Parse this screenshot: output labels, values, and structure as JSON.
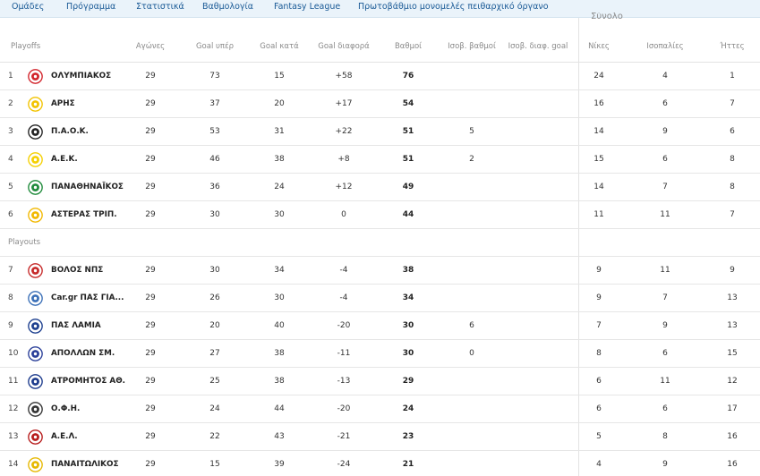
{
  "nav": {
    "items": [
      "Ομάδες",
      "Πρόγραμμα",
      "Στατιστικά",
      "Βαθμολογία",
      "Fantasy League",
      "Πρωτοβάθμιο μονομελές πειθαρχικό όργανο"
    ]
  },
  "group_header_partial": "Σύνολο",
  "table": {
    "playoffs_label": "Playoffs",
    "playouts_label": "Playouts",
    "columns": [
      "Αγώνες",
      "Goal υπέρ",
      "Goal κατά",
      "Goal διαφορά",
      "Βαθμοί",
      "Ισοβ. βαθμοί",
      "Ισοβ. διαφ. goal",
      "Νίκες",
      "Ισοπαλίες",
      "Ήττες"
    ],
    "playoffs": [
      {
        "rank": "1",
        "team": "ΟΛΥΜΠΙΑΚΟΣ",
        "played": "29",
        "gf": "73",
        "ga": "15",
        "gd": "+58",
        "pts": "76",
        "tie_pts": "",
        "tie_gd": "",
        "w": "24",
        "d": "4",
        "l": "1",
        "logo_color": "#d2232a",
        "logo_icon": "olympiacos-logo-icon"
      },
      {
        "rank": "2",
        "team": "ΑΡΗΣ",
        "played": "29",
        "gf": "37",
        "ga": "20",
        "gd": "+17",
        "pts": "54",
        "tie_pts": "",
        "tie_gd": "",
        "w": "16",
        "d": "6",
        "l": "7",
        "logo_color": "#f2c300",
        "logo_icon": "aris-logo-icon"
      },
      {
        "rank": "3",
        "team": "Π.Α.Ο.Κ.",
        "played": "29",
        "gf": "53",
        "ga": "31",
        "gd": "+22",
        "pts": "51",
        "tie_pts": "5",
        "tie_gd": "",
        "w": "14",
        "d": "9",
        "l": "6",
        "logo_color": "#222222",
        "logo_icon": "paok-logo-icon"
      },
      {
        "rank": "4",
        "team": "Α.Ε.Κ.",
        "played": "29",
        "gf": "46",
        "ga": "38",
        "gd": "+8",
        "pts": "51",
        "tie_pts": "2",
        "tie_gd": "",
        "w": "15",
        "d": "6",
        "l": "8",
        "logo_color": "#f5d000",
        "logo_icon": "aek-logo-icon"
      },
      {
        "rank": "5",
        "team": "ΠΑΝΑΘΗΝΑΪΚΟΣ",
        "played": "29",
        "gf": "36",
        "ga": "24",
        "gd": "+12",
        "pts": "49",
        "tie_pts": "",
        "tie_gd": "",
        "w": "14",
        "d": "7",
        "l": "8",
        "logo_color": "#1e8a3a",
        "logo_icon": "panathinaikos-logo-icon"
      },
      {
        "rank": "6",
        "team": "ΑΣΤΕΡΑΣ ΤΡΙΠ.",
        "played": "29",
        "gf": "30",
        "ga": "30",
        "gd": "0",
        "pts": "44",
        "tie_pts": "",
        "tie_gd": "",
        "w": "11",
        "d": "11",
        "l": "7",
        "logo_color": "#f2b800",
        "logo_icon": "asteras-logo-icon"
      }
    ],
    "playouts": [
      {
        "rank": "7",
        "team": "ΒΟΛΟΣ ΝΠΣ",
        "played": "29",
        "gf": "30",
        "ga": "34",
        "gd": "-4",
        "pts": "38",
        "tie_pts": "",
        "tie_gd": "",
        "w": "9",
        "d": "11",
        "l": "9",
        "logo_color": "#c62828",
        "logo_icon": "volos-logo-icon"
      },
      {
        "rank": "8",
        "team": "Car.gr ΠΑΣ ΓΙΑ...",
        "played": "29",
        "gf": "26",
        "ga": "30",
        "gd": "-4",
        "pts": "34",
        "tie_pts": "",
        "tie_gd": "",
        "w": "9",
        "d": "7",
        "l": "13",
        "logo_color": "#3a6fb7",
        "logo_icon": "pas-giannina-logo-icon"
      },
      {
        "rank": "9",
        "team": "ΠΑΣ ΛΑΜΙΑ",
        "played": "29",
        "gf": "20",
        "ga": "40",
        "gd": "-20",
        "pts": "30",
        "tie_pts": "6",
        "tie_gd": "",
        "w": "7",
        "d": "9",
        "l": "13",
        "logo_color": "#1d3f8f",
        "logo_icon": "lamia-logo-icon"
      },
      {
        "rank": "10",
        "team": "ΑΠΟΛΛΩΝ ΣΜ.",
        "played": "29",
        "gf": "27",
        "ga": "38",
        "gd": "-11",
        "pts": "30",
        "tie_pts": "0",
        "tie_gd": "",
        "w": "8",
        "d": "6",
        "l": "15",
        "logo_color": "#2a3f99",
        "logo_icon": "apollon-logo-icon"
      },
      {
        "rank": "11",
        "team": "ΑΤΡΟΜΗΤΟΣ ΑΘ.",
        "played": "29",
        "gf": "25",
        "ga": "38",
        "gd": "-13",
        "pts": "29",
        "tie_pts": "",
        "tie_gd": "",
        "w": "6",
        "d": "11",
        "l": "12",
        "logo_color": "#1b3a8c",
        "logo_icon": "atromitos-logo-icon"
      },
      {
        "rank": "12",
        "team": "Ο.Φ.Η.",
        "played": "29",
        "gf": "24",
        "ga": "44",
        "gd": "-20",
        "pts": "24",
        "tie_pts": "",
        "tie_gd": "",
        "w": "6",
        "d": "6",
        "l": "17",
        "logo_color": "#333333",
        "logo_icon": "ofi-logo-icon"
      },
      {
        "rank": "13",
        "team": "Α.Ε.Λ.",
        "played": "29",
        "gf": "22",
        "ga": "43",
        "gd": "-21",
        "pts": "23",
        "tie_pts": "",
        "tie_gd": "",
        "w": "5",
        "d": "8",
        "l": "16",
        "logo_color": "#b71c1c",
        "logo_icon": "ael-logo-icon"
      },
      {
        "rank": "14",
        "team": "ΠΑΝΑΙΤΩΛΙΚΟΣ",
        "played": "29",
        "gf": "15",
        "ga": "39",
        "gd": "-24",
        "pts": "21",
        "tie_pts": "",
        "tie_gd": "",
        "w": "4",
        "d": "9",
        "l": "16",
        "logo_color": "#e6b800",
        "logo_icon": "panaitolikos-logo-icon"
      }
    ]
  }
}
